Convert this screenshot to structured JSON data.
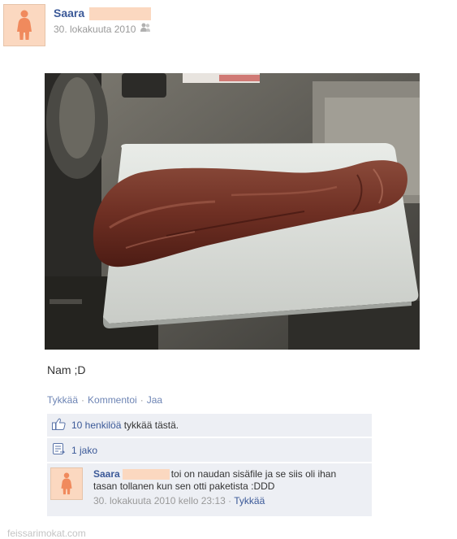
{
  "post": {
    "author": "Saara",
    "timestamp": "30. lokakuuta 2010",
    "audience_icon": "friends-icon",
    "message": "Nam ;D"
  },
  "actions": {
    "like": "Tykkää",
    "comment": "Kommentoi",
    "share": "Jaa",
    "separator": "·"
  },
  "likes": {
    "count_text": "10 henkilöä",
    "rest_text": " tykkää tästä."
  },
  "shares": {
    "text": "1 jako"
  },
  "comment": {
    "author": "Saara",
    "text_line1": "toi on naudan sisäfile ja se siis oli ihan",
    "text_line2": "tasan tollanen kun sen otti paketista :DDD",
    "timestamp": "30. lokakuuta 2010 kello 23:13",
    "separator": "·",
    "like": "Tykkää"
  },
  "watermark": "feissarimokat.com",
  "colors": {
    "link": "#3b5998",
    "avatar_bg": "#fbd8c0",
    "avatar_figure": "#f08a5d",
    "ufi_bg": "#edeff4"
  }
}
